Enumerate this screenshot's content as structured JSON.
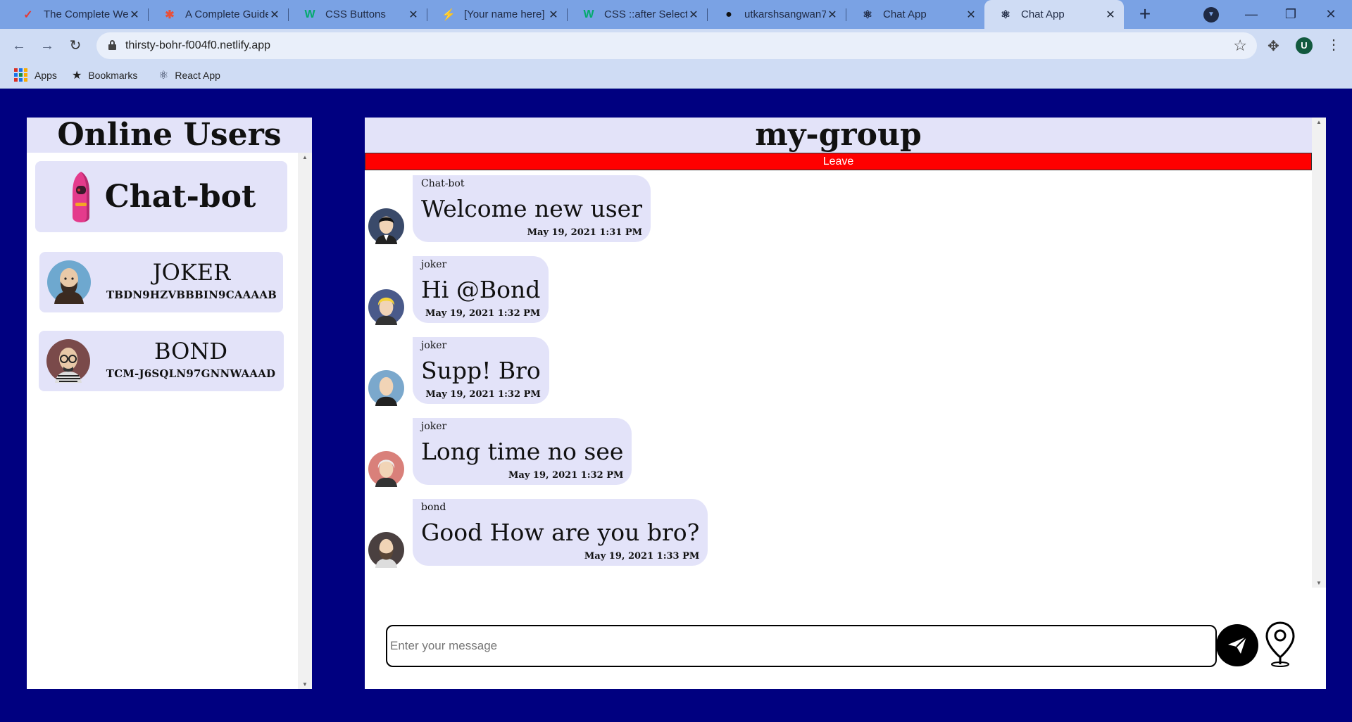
{
  "browser": {
    "tabs": [
      {
        "title": "The Complete We",
        "favicon": "red-swoosh-icon",
        "color": "#e53935"
      },
      {
        "title": "A Complete Guide",
        "favicon": "asterisk-icon",
        "color": "#e8503a"
      },
      {
        "title": "CSS Buttons",
        "favicon": "w3schools-icon",
        "color": "#04aa6d"
      },
      {
        "title": "[Your name here]",
        "favicon": "lightning-icon",
        "color": "#f5a623"
      },
      {
        "title": "CSS ::after Selecto",
        "favicon": "w3schools-icon",
        "color": "#04aa6d"
      },
      {
        "title": "utkarshsangwan7",
        "favicon": "github-icon",
        "color": "#111111"
      },
      {
        "title": "Chat App",
        "favicon": "react-icon",
        "color": "#1f2a44"
      },
      {
        "title": "Chat App",
        "favicon": "react-icon",
        "color": "#1f2a44"
      }
    ],
    "url": "thirsty-bohr-f004f0.netlify.app",
    "profile_initial": "U",
    "bookmarks": [
      {
        "label": "Apps",
        "icon": "apps-grid-icon"
      },
      {
        "label": "Bookmarks",
        "icon": "star-icon"
      },
      {
        "label": "React App",
        "icon": "react-icon"
      }
    ]
  },
  "colors": {
    "page_background": "#000080",
    "panel_header": "#e3e3f9",
    "bubble": "#e3e3f9",
    "leave_button": "#ff0000"
  },
  "users_panel": {
    "title": "Online Users",
    "bot": {
      "name": "Chat-bot"
    },
    "users": [
      {
        "name": "JOKER",
        "id": "TBDN9HZVBBBIN9CAAAAB",
        "avatar": "bald-bearded-man-avatar"
      },
      {
        "name": "BOND",
        "id": "TCM-J6SQLN97GNNWAAAD",
        "avatar": "glasses-bald-man-avatar"
      }
    ]
  },
  "chat": {
    "room_name": "my-group",
    "leave_label": "Leave",
    "messages": [
      {
        "sender": "Chat-bot",
        "text": "Welcome new user",
        "time": "May 19, 2021 1:31 PM",
        "avatar": "dark-hair-man-avatar"
      },
      {
        "sender": "joker",
        "text": "Hi @Bond",
        "time": "May 19, 2021 1:32 PM",
        "avatar": "blonde-man-avatar"
      },
      {
        "sender": "joker",
        "text": "Supp! Bro",
        "time": "May 19, 2021 1:32 PM",
        "avatar": "bald-man-avatar"
      },
      {
        "sender": "joker",
        "text": "Long time no see",
        "time": "May 19, 2021 1:32 PM",
        "avatar": "white-hair-man-avatar"
      },
      {
        "sender": "bond",
        "text": "Good How are you bro?",
        "time": "May 19, 2021 1:33 PM",
        "avatar": "bearded-man-avatar"
      }
    ],
    "input_placeholder": "Enter your message",
    "input_value": "",
    "send_icon": "paper-plane-icon",
    "location_icon": "map-pin-icon"
  }
}
